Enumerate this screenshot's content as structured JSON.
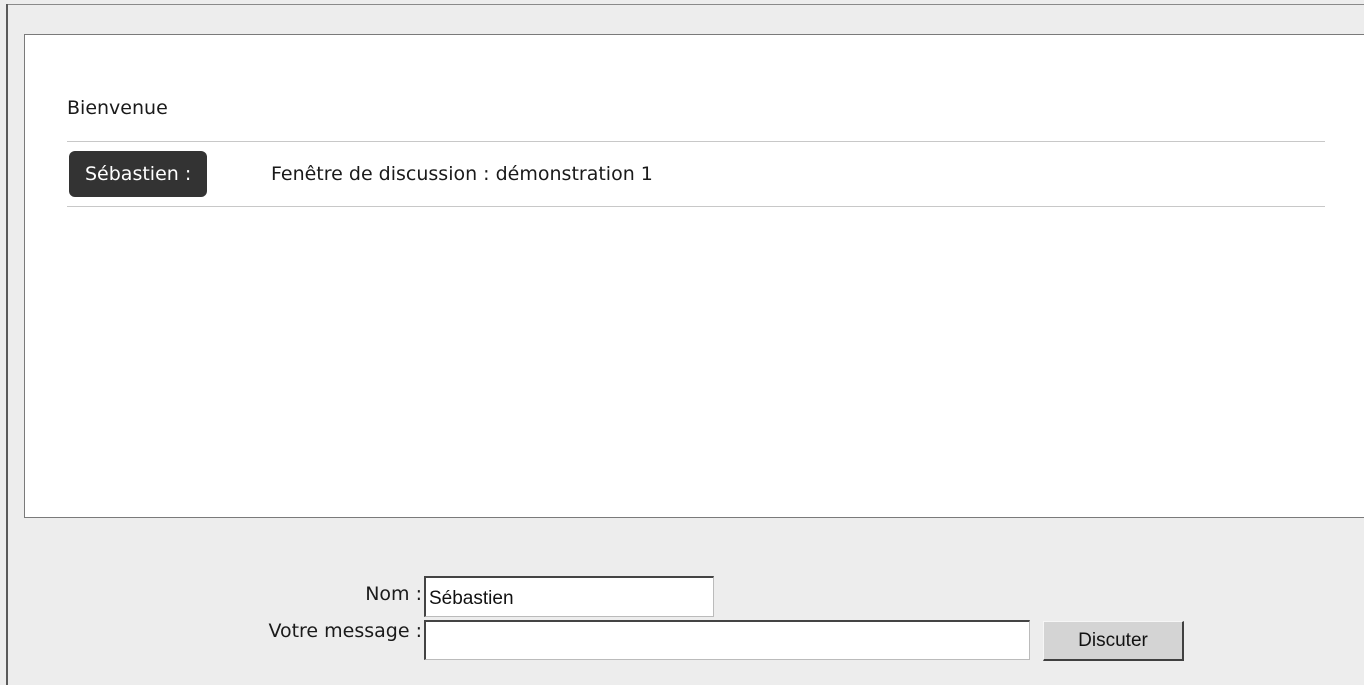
{
  "chat": {
    "welcome": "Bienvenue",
    "messages": [
      {
        "author": "Sébastien :",
        "text": "Fenêtre de discussion : démonstration 1"
      }
    ]
  },
  "form": {
    "name_label": "Nom :",
    "name_value": "Sébastien",
    "message_label": "Votre message :",
    "message_value": "",
    "submit_label": "Discuter"
  },
  "colors": {
    "page_background": "#ededed",
    "chat_background": "#ffffff",
    "author_badge": "#333333",
    "button": "#d4d4d4"
  }
}
